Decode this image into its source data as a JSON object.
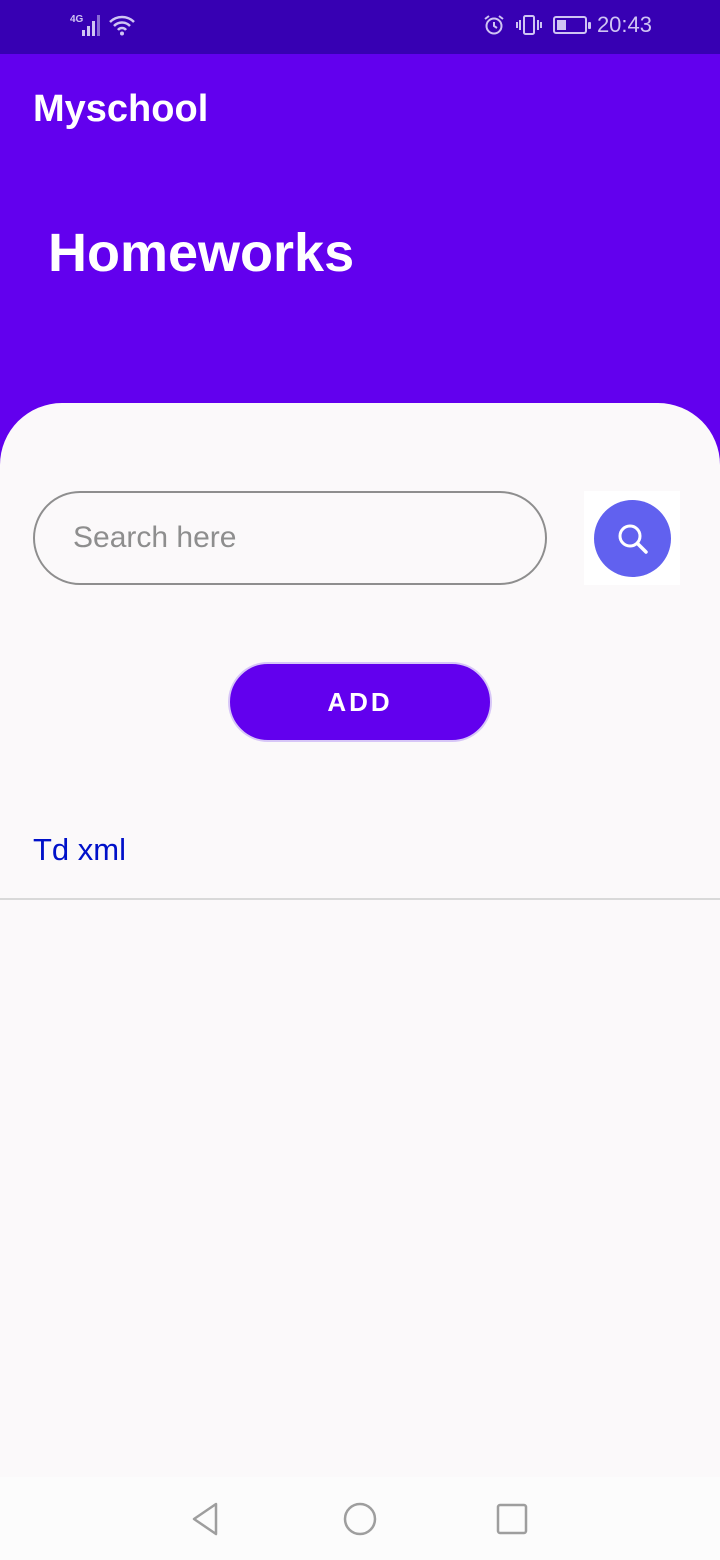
{
  "status_bar": {
    "network": "4G",
    "time": "20:43",
    "icons": [
      "signal-icon",
      "wifi-icon",
      "alarm-icon",
      "vibrate-icon",
      "battery-icon"
    ]
  },
  "app_bar": {
    "title": "Myschool"
  },
  "header": {
    "title": "Homeworks"
  },
  "search": {
    "placeholder": "Search here",
    "value": "",
    "button_icon": "search-icon"
  },
  "actions": {
    "add_label": "ADD"
  },
  "homeworks": [
    {
      "title": "Td xml"
    }
  ],
  "nav": {
    "icons": [
      "back-icon",
      "home-icon",
      "recents-icon"
    ]
  },
  "colors": {
    "primary": "#6200EE",
    "primary_dark": "#3700B3",
    "search_button": "#6161EF",
    "item_text": "#0011C9",
    "background": "#FBF9FA"
  }
}
